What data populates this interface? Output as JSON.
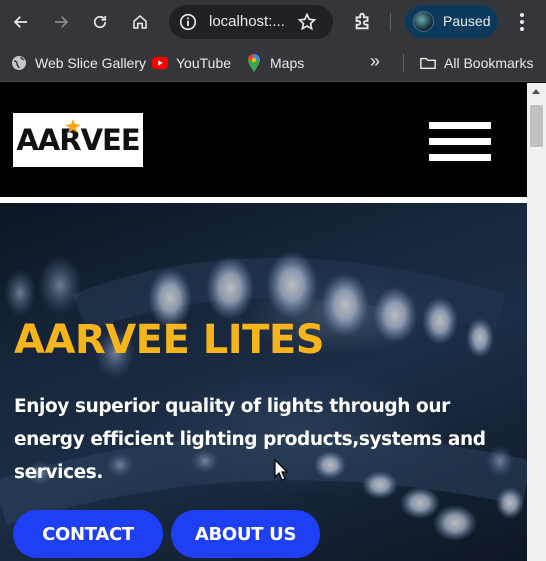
{
  "browser": {
    "url": "localhost:...",
    "profile_label": "Paused",
    "bookmarks": [
      {
        "label": "Web Slice Gallery",
        "icon": "globe-icon"
      },
      {
        "label": "YouTube",
        "icon": "youtube-icon"
      },
      {
        "label": "Maps",
        "icon": "maps-pin-icon"
      }
    ],
    "overflow_label": "»",
    "all_bookmarks_label": "All Bookmarks"
  },
  "site": {
    "logo_text_a": "AA",
    "logo_text_k": "R",
    "logo_text_b": "VEE",
    "menu_icon": "hamburger-menu-icon"
  },
  "hero": {
    "title": "AARVEE LITES",
    "subtitle": "Enjoy superior quality of lights through our energy efficient lighting products,systems and services.",
    "contact_label": "CONTACT",
    "about_label": "ABOUT US"
  },
  "colors": {
    "accent_yellow": "#f7b51c",
    "button_blue": "#1f3ff5",
    "chrome_bg": "#35363a",
    "profile_bg": "#0b3a5c"
  }
}
